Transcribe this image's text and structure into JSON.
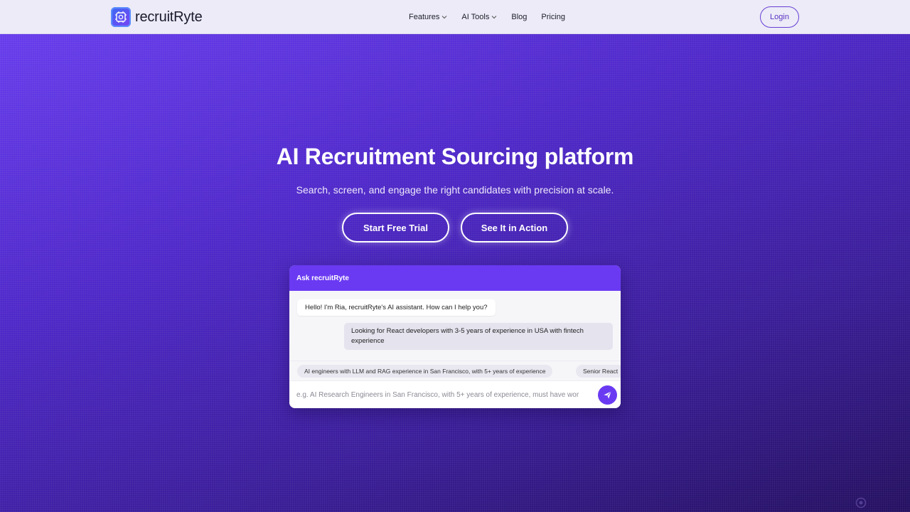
{
  "brand": {
    "name": "recruitRyte",
    "logo_icon": "ai-chip-logo-icon"
  },
  "nav": {
    "items": [
      {
        "label": "Features",
        "has_dropdown": true
      },
      {
        "label": "AI Tools",
        "has_dropdown": true
      },
      {
        "label": "Blog",
        "has_dropdown": false
      },
      {
        "label": "Pricing",
        "has_dropdown": false
      }
    ],
    "login_label": "Login"
  },
  "hero": {
    "title": "AI Recruitment Sourcing platform",
    "subtitle": "Search, screen, and engage the right candidates with precision at scale.",
    "cta_primary": "Start Free Trial",
    "cta_secondary": "See It in Action"
  },
  "chat": {
    "header": "Ask recruitRyte",
    "messages": [
      {
        "role": "assistant",
        "text": "Hello! I'm Ria, recruitRyte's AI assistant. How can I help you?"
      },
      {
        "role": "user",
        "text": "Looking for React developers with 3-5 years of experience in USA with fintech experience"
      }
    ],
    "suggestions": [
      "AI engineers with LLM and RAG experience in San Francisco, with 5+ years of experience",
      "Senior React"
    ],
    "input_placeholder": "e.g. AI Research Engineers in San Francisco, with 5+ years of experience, must have wor",
    "send_icon": "paper-plane-send-icon"
  },
  "colors": {
    "accent": "#6a3af2",
    "hero_gradient_start": "#6a3ff0",
    "hero_gradient_end": "#241060",
    "navbar_bg": "#ecebf7",
    "login_border": "#6a3fd6"
  }
}
